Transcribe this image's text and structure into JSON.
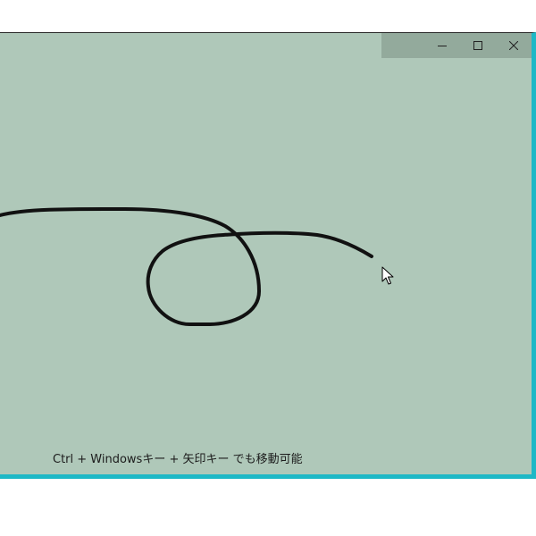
{
  "window": {
    "background_color": "#afc8b9",
    "accent_border_color": "#1eb8c6",
    "controls": {
      "minimize_icon": "minimize-icon",
      "maximize_icon": "maximize-icon",
      "close_icon": "close-icon"
    }
  },
  "canvas": {
    "stroke_color": "#111111",
    "hint_text": "Ctrl + Windowsキー + 矢印キー でも移動可能"
  },
  "pointer": {
    "icon": "arrow-cursor-icon"
  }
}
